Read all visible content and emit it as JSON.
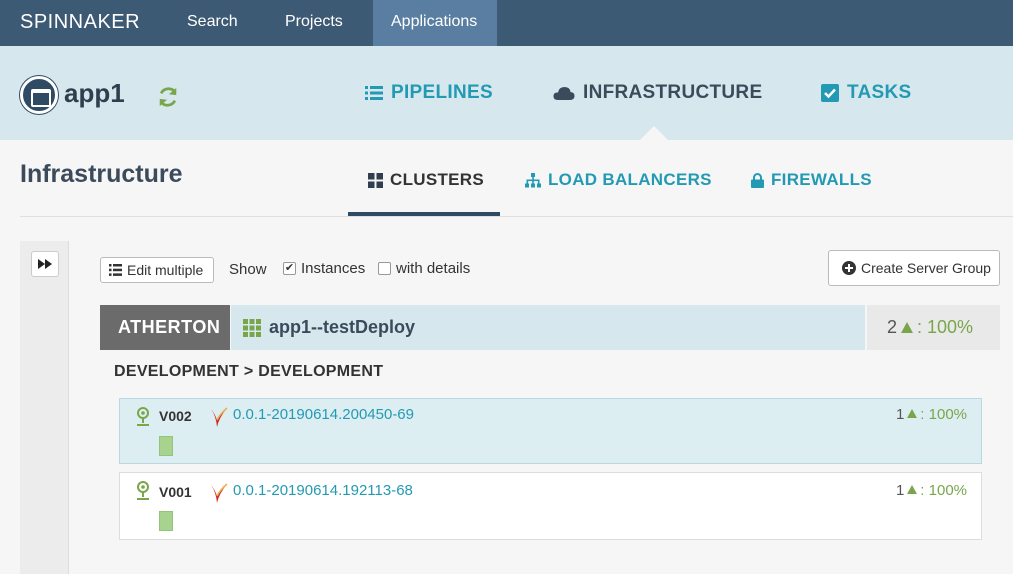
{
  "topnav": {
    "brand": "SPINNAKER",
    "items": [
      {
        "label": "Search",
        "active": false
      },
      {
        "label": "Projects",
        "active": false
      },
      {
        "label": "Applications",
        "active": true
      }
    ]
  },
  "app": {
    "name": "app1",
    "refresh_icon": "refresh-icon",
    "sections": [
      {
        "label": "PIPELINES",
        "icon": "list-icon",
        "active": false
      },
      {
        "label": "INFRASTRUCTURE",
        "icon": "cloud-icon",
        "active": true
      },
      {
        "label": "TASKS",
        "icon": "check-square-icon",
        "active": false
      }
    ]
  },
  "infrastructure": {
    "title": "Infrastructure",
    "tabs": [
      {
        "label": "CLUSTERS",
        "icon": "grid-icon",
        "active": true
      },
      {
        "label": "LOAD BALANCERS",
        "icon": "sitemap-icon",
        "active": false
      },
      {
        "label": "FIREWALLS",
        "icon": "lock-icon",
        "active": false
      }
    ]
  },
  "controls": {
    "edit_multiple": "Edit multiple",
    "show_label": "Show",
    "instances_label": "Instances",
    "instances_checked": true,
    "details_label": "with details",
    "details_checked": false,
    "create_server_group": "Create Server Group"
  },
  "cluster": {
    "account": "ATHERTON",
    "name": "app1--testDeploy",
    "health_count": "2",
    "health_percent": ": 100%",
    "region": "DEVELOPMENT > DEVELOPMENT",
    "server_groups": [
      {
        "version": "V002",
        "build": "0.0.1-20190614.200450-69",
        "health_count": "1",
        "health_percent": ": 100%",
        "active": true
      },
      {
        "version": "V001",
        "build": "0.0.1-20190614.192113-68",
        "health_count": "1",
        "health_percent": ": 100%",
        "active": false
      }
    ]
  },
  "colors": {
    "topbar": "#3d5a75",
    "topbar_active": "#5a7ea1",
    "header_bg": "#d6e8ee",
    "accent_teal": "#239ab3",
    "healthy_green": "#79a64b",
    "instance_green": "#a8d38f",
    "account_badge": "#6b6b6b"
  }
}
